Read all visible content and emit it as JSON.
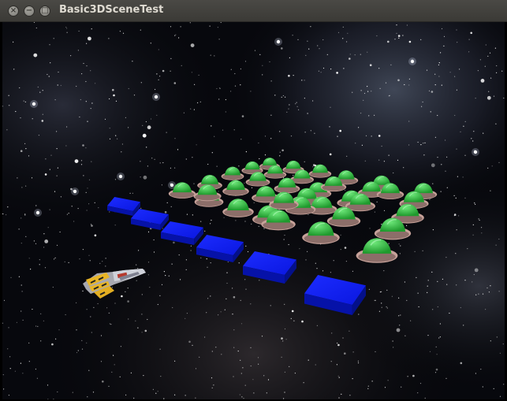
{
  "window": {
    "title": "Basic3DSceneTest",
    "close_glyph": "×",
    "minimize_glyph": "−",
    "maximize_glyph": "□"
  },
  "scene": {
    "background": "starfield-nebula",
    "player_ship_icon": "spaceship-icon",
    "shield_block_color": "#0a1bf2",
    "invader_color": "#31c43f",
    "invader_base_color": "#c9a39a",
    "shield_count": 6,
    "invader_count": 37
  }
}
